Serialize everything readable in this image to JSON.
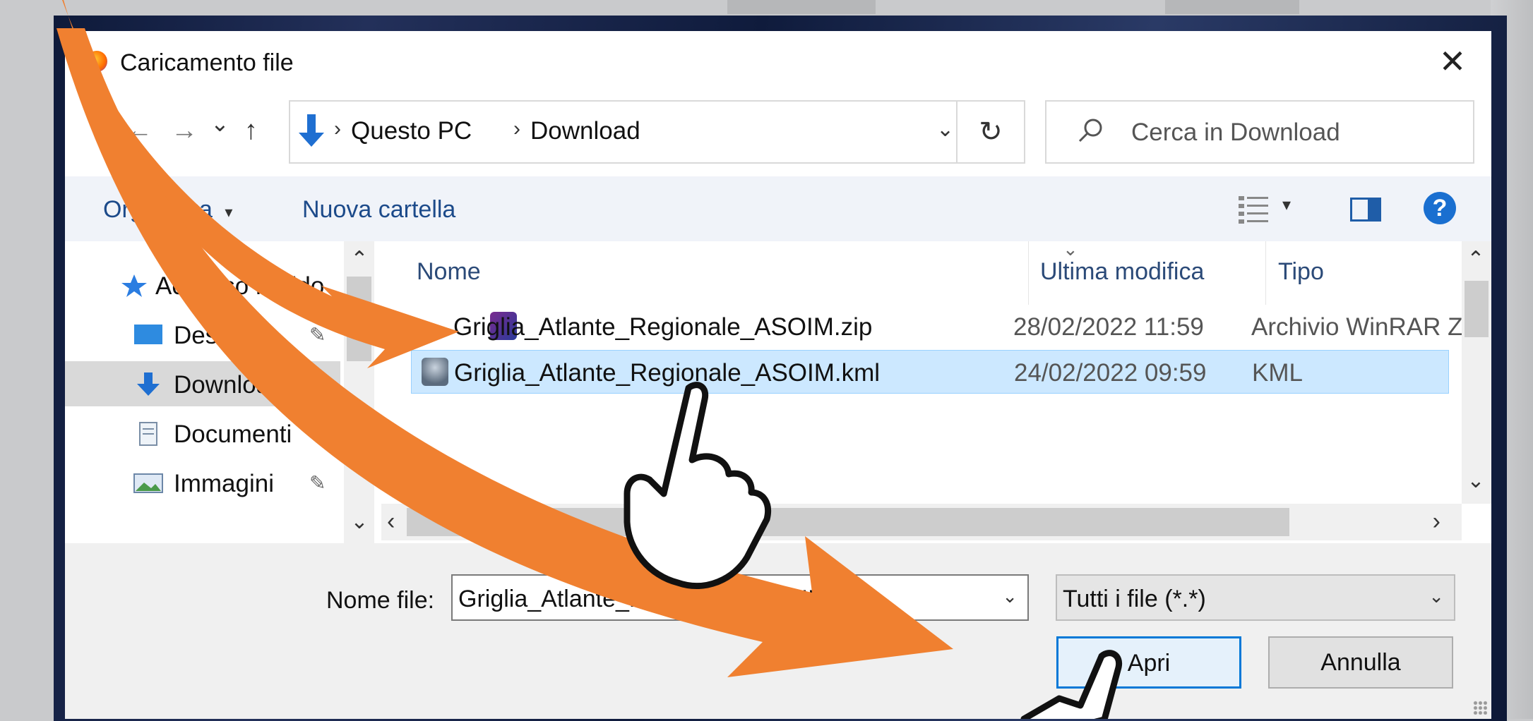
{
  "dialog": {
    "title": "Caricamento file"
  },
  "nav": {
    "back": "←",
    "forward": "→",
    "recent": "⌄",
    "up": "↑"
  },
  "address": {
    "crumbs": [
      "Questo PC",
      "Download"
    ],
    "separator": "›",
    "dropdown": "⌄",
    "refresh": "↻"
  },
  "search": {
    "placeholder": "Cerca in Download"
  },
  "toolbar": {
    "organize": "Organizza",
    "organize_caret": "▾",
    "new_folder": "Nuova cartella",
    "view_caret": "▾",
    "help": "?"
  },
  "navpane": {
    "items": [
      {
        "label": "Accesso rapido",
        "icon": "star-icon",
        "pinned": false
      },
      {
        "label": "Desktop",
        "icon": "desktop-icon",
        "pinned": true
      },
      {
        "label": "Download",
        "icon": "download-icon",
        "pinned": false,
        "selected": true
      },
      {
        "label": "Documenti",
        "icon": "documents-icon",
        "pinned": true
      },
      {
        "label": "Immagini",
        "icon": "pictures-icon",
        "pinned": true
      }
    ],
    "pin_glyph": "📌"
  },
  "files": {
    "columns": [
      "Nome",
      "Ultima modifica",
      "Tipo"
    ],
    "sort_caret": "⌄",
    "rows": [
      {
        "name": "Griglia_Atlante_Regionale_ASOIM.zip",
        "modified": "28/02/2022 11:59",
        "type": "Archivio WinRAR ZIP",
        "icon": "winrar-zip-icon",
        "selected": false
      },
      {
        "name": "Griglia_Atlante_Regionale_ASOIM.kml",
        "modified": "24/02/2022 09:59",
        "type": "KML",
        "icon": "kml-file-icon",
        "selected": true
      }
    ]
  },
  "footer": {
    "filename_label": "Nome file:",
    "filename_value": "Griglia_Atlante_Regionale_ASOIM.kml",
    "filetype_value": "Tutti i file (*.*)",
    "open_button": "Apri",
    "cancel_button": "Annulla",
    "dropdown": "⌄"
  },
  "colors": {
    "accent": "#0078d7",
    "arrow": "#f08030",
    "selection": "#cce8ff",
    "link": "#1c4a8a"
  }
}
